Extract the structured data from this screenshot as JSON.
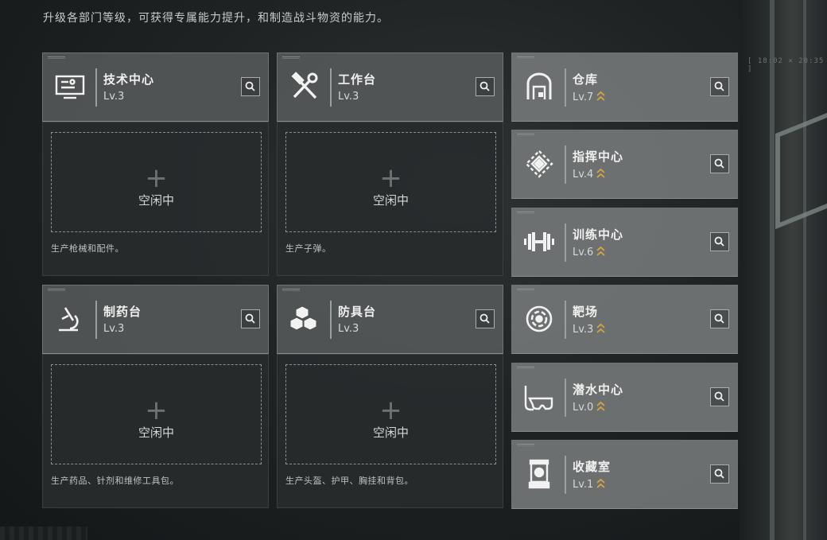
{
  "subtitle": "升级各部门等级，可获得专属能力提升，和制造战斗物资的能力。",
  "background": {
    "time_readout": "[ 18:02 × 20:35 ]"
  },
  "workshops": [
    {
      "name": "技术中心",
      "level": "Lv.3",
      "icon": "computer-terminal-icon",
      "slot_status": "空闲中",
      "description": "生产枪械和配件。"
    },
    {
      "name": "工作台",
      "level": "Lv.3",
      "icon": "hammer-wrench-icon",
      "slot_status": "空闲中",
      "description": "生产子弹。"
    },
    {
      "name": "制药台",
      "level": "Lv.3",
      "icon": "microscope-icon",
      "slot_status": "空闲中",
      "description": "生产药品、针剂和维修工具包。"
    },
    {
      "name": "防具台",
      "level": "Lv.3",
      "icon": "cubes-icon",
      "slot_status": "空闲中",
      "description": "生产头盔、护甲、胸挂和背包。"
    }
  ],
  "facilities": [
    {
      "name": "仓库",
      "level": "Lv.7",
      "icon": "warehouse-icon",
      "upgradable": true
    },
    {
      "name": "指挥中心",
      "level": "Lv.4",
      "icon": "command-diamond-icon",
      "upgradable": true
    },
    {
      "name": "训练中心",
      "level": "Lv.6",
      "icon": "dumbbell-icon",
      "upgradable": true
    },
    {
      "name": "靶场",
      "level": "Lv.3",
      "icon": "target-icon",
      "upgradable": true
    },
    {
      "name": "潜水中心",
      "level": "Lv.0",
      "icon": "diving-mask-icon",
      "upgradable": true
    },
    {
      "name": "收藏室",
      "level": "Lv.1",
      "icon": "display-case-icon",
      "upgradable": true
    }
  ],
  "colors": {
    "upgrade_arrow": "#d9a441",
    "card_bg": "#585c5c",
    "panel_bg": "#282b2c"
  }
}
